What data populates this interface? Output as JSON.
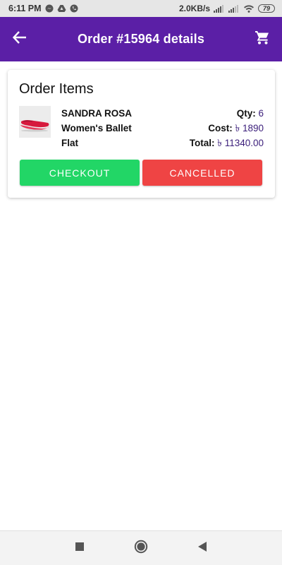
{
  "status_bar": {
    "time": "6:11 PM",
    "net_speed": "2.0KB/s",
    "battery": "79"
  },
  "app_bar": {
    "title": "Order #15964 details",
    "back_icon": "arrow-left-icon",
    "cart_icon": "shopping-cart-icon",
    "color": "#5b1fa6"
  },
  "order_items": {
    "heading": "Order Items",
    "item": {
      "name_lines": [
        "SANDRA ROSA",
        "Women's Ballet",
        "Flat"
      ],
      "qty_label": "Qty:",
      "qty_value": "6",
      "cost_label": "Cost:",
      "cost_value": "৳ 1890",
      "total_label": "Total:",
      "total_value": "৳ 11340.00"
    },
    "checkout_label": "CHECKOUT",
    "cancelled_label": "CANCELLED",
    "checkout_color": "#22d666",
    "cancelled_color": "#ef4444"
  },
  "nav_bar": {
    "icons": [
      "square-recents-icon",
      "circle-home-icon",
      "triangle-back-icon"
    ]
  }
}
